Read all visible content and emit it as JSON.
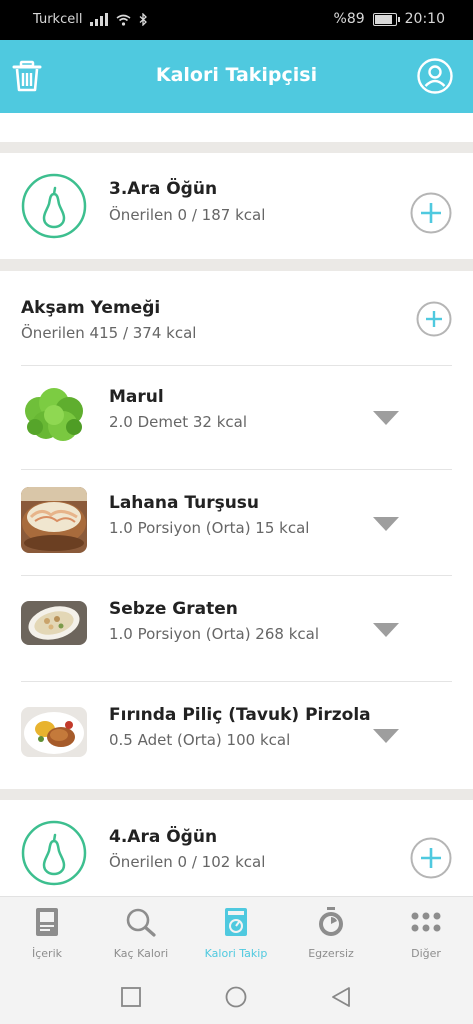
{
  "status_bar": {
    "carrier": "Turkcell",
    "battery": "%89",
    "time": "20:10"
  },
  "header": {
    "title": "Kalori Takipçisi"
  },
  "snack3": {
    "title": "3.Ara Öğün",
    "recommended": "Önerilen 0 / 187 kcal"
  },
  "dinner": {
    "title": "Akşam Yemeği",
    "recommended": "Önerilen 415 / 374 kcal",
    "items": [
      {
        "name": "Marul",
        "detail": "2.0 Demet 32 kcal"
      },
      {
        "name": "Lahana Turşusu",
        "detail": "1.0 Porsiyon (Orta) 15 kcal"
      },
      {
        "name": "Sebze Graten",
        "detail": "1.0 Porsiyon (Orta) 268 kcal"
      },
      {
        "name": "Fırında Piliç (Tavuk) Pirzola",
        "detail": "0.5 Adet (Orta) 100 kcal"
      }
    ]
  },
  "snack4": {
    "title": "4.Ara Öğün",
    "recommended": "Önerilen 0 / 102 kcal"
  },
  "bottom_nav": [
    {
      "label": "İçerik",
      "icon": "book-icon"
    },
    {
      "label": "Kaç Kalori",
      "icon": "search-icon"
    },
    {
      "label": "Kalori Takip",
      "icon": "scale-icon",
      "active": true
    },
    {
      "label": "Egzersiz",
      "icon": "stopwatch-icon"
    },
    {
      "label": "Diğer",
      "icon": "dots-icon"
    }
  ],
  "colors": {
    "accent": "#4fc9df",
    "pear": "#3dbf8f"
  }
}
